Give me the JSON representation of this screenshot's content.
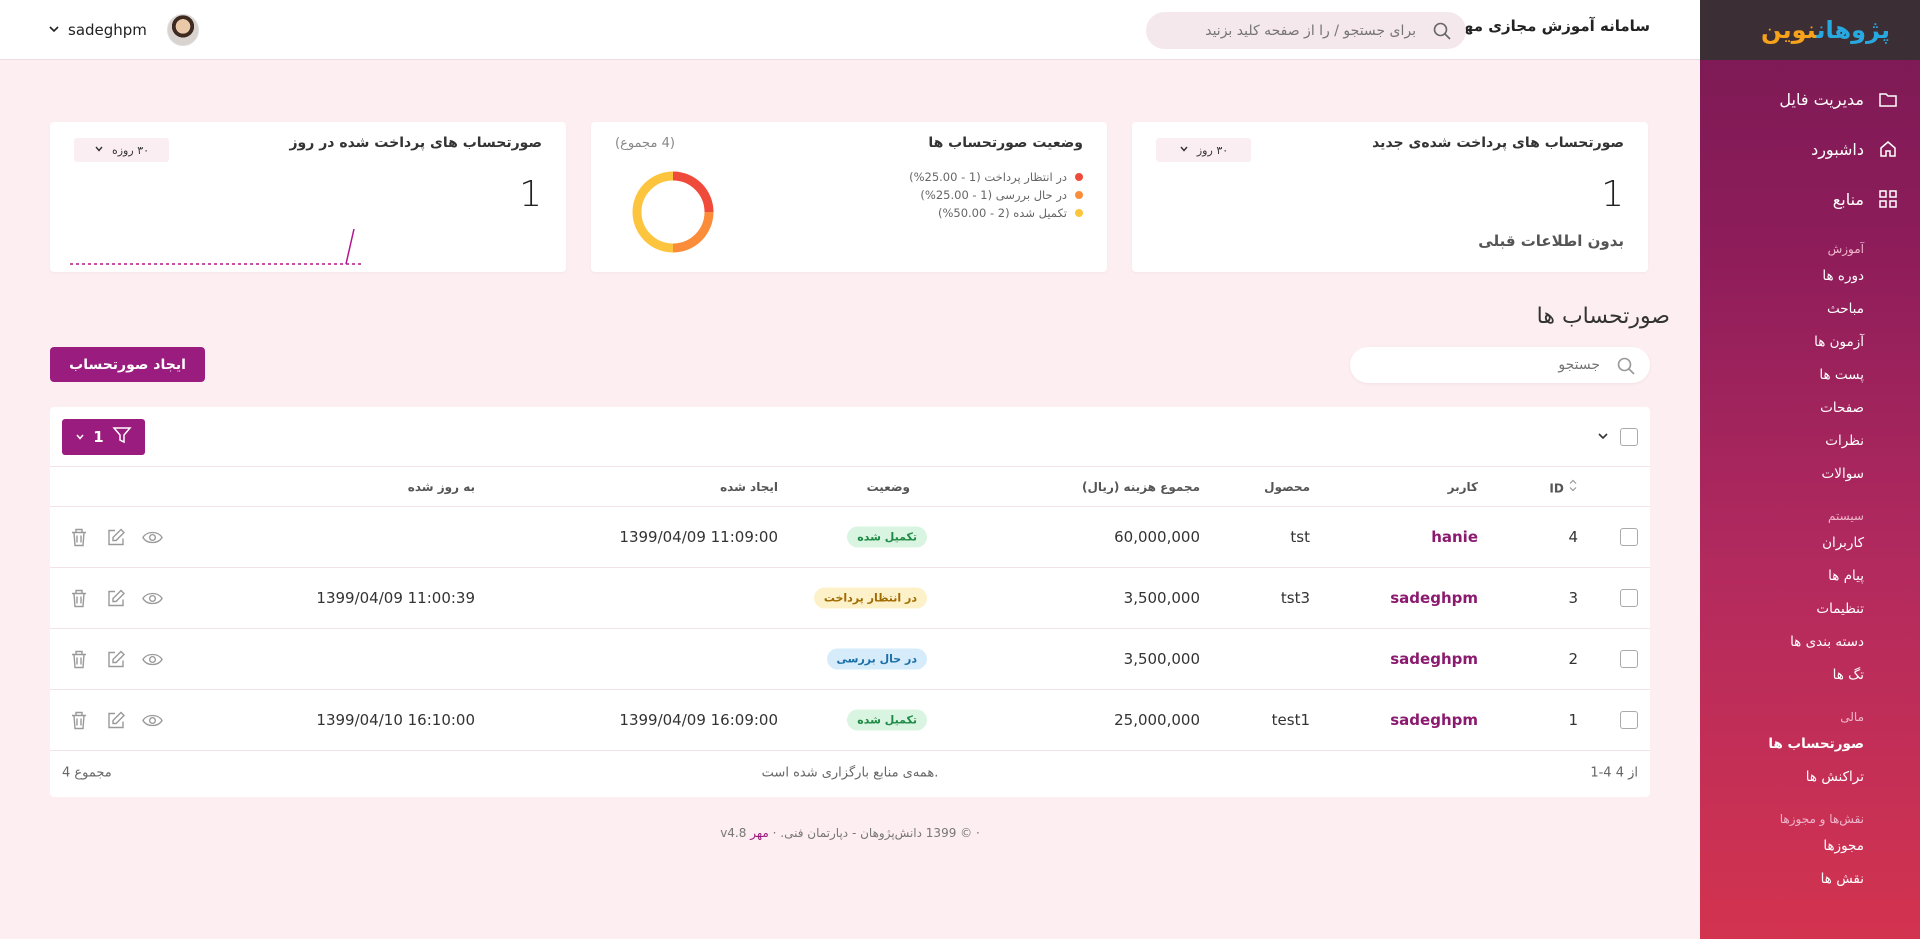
{
  "app": {
    "title": "سامانه آموزش مجازی مهر",
    "logo_text_a": "نوین",
    "logo_text_b": "پژوهان",
    "brand_color": "#9a1c7e"
  },
  "header": {
    "search_placeholder": "برای جستجو / را از صفحه کلید بزنید",
    "username": "sadeghpm"
  },
  "sidebar": {
    "main": [
      {
        "label": "مدیریت فایل",
        "icon": "folder-icon"
      },
      {
        "label": "داشبورد",
        "icon": "home-icon"
      },
      {
        "label": "منابع",
        "icon": "grid-icon"
      }
    ],
    "groups": [
      {
        "title": "آموزش",
        "items": [
          "دوره ها",
          "مباحث",
          "آزمون ها",
          "پست ها",
          "صفحات",
          "نظرات",
          "سوالات"
        ]
      },
      {
        "title": "سیستم",
        "items": [
          "کاربران",
          "پیام ها",
          "تنظیمات",
          "دسته بندی ها",
          "تگ ها"
        ]
      },
      {
        "title": "مالی",
        "items": [
          "صورتحساب ها",
          "تراکنش ها"
        ]
      },
      {
        "title": "نقش‌ها و مجوزها",
        "items": [
          "مجوزها",
          "نقش ها"
        ]
      }
    ],
    "active_item": "صورتحساب ها"
  },
  "cards": {
    "new_paid": {
      "title": "صورتحساب های پرداخت شده‌ی جدید",
      "period": "۳۰ روز",
      "value": "1",
      "sub": "بدون اطلاعات قبلی"
    },
    "status": {
      "title": "وضعیت صورتحساب ها",
      "total_note": "(4 مجموع)",
      "legend": [
        {
          "label": "در انتظار پرداخت (1 - 25.00%)",
          "color": "#f04a3a",
          "fraction": 0.25
        },
        {
          "label": "در حال بررسی (1 - 25.00%)",
          "color": "#fb8c3a",
          "fraction": 0.25
        },
        {
          "label": "تکمیل شده (2 - 50.00%)",
          "color": "#fcc53d",
          "fraction": 0.5
        }
      ]
    },
    "per_day": {
      "title": "صورتحساب های پرداخت شده در روز",
      "period": "۳۰ روزه",
      "value": "1"
    }
  },
  "section": {
    "title": "صورتحساب ها",
    "create_button": "ایجاد صورتحساب",
    "search_placeholder": "جستجو",
    "filter_count": "1"
  },
  "table": {
    "columns": {
      "id": "ID",
      "user": "کاربر",
      "product": "محصول",
      "total": "مجموع هزینه (ریال)",
      "status": "وضعیت",
      "created": "ایجاد شده",
      "updated": "به روز شده"
    },
    "rows": [
      {
        "id": "4",
        "user": "hanie",
        "product": "tst",
        "total": "60,000,000",
        "status": "تکمیل شده",
        "status_kind": "green",
        "created": "1399/04/09 11:09:00",
        "updated": ""
      },
      {
        "id": "3",
        "user": "sadeghpm",
        "product": "tst3",
        "total": "3,500,000",
        "status": "در انتظار پرداخت",
        "status_kind": "yellow",
        "created": "",
        "updated": "1399/04/09 11:00:39"
      },
      {
        "id": "2",
        "user": "sadeghpm",
        "product": "",
        "total": "3,500,000",
        "status": "در حال بررسی",
        "status_kind": "blue",
        "created": "",
        "updated": ""
      },
      {
        "id": "1",
        "user": "sadeghpm",
        "product": "test1",
        "total": "25,000,000",
        "status": "تکمیل شده",
        "status_kind": "green",
        "created": "1399/04/09 16:09:00",
        "updated": "1399/04/10 16:10:00"
      }
    ],
    "footer": {
      "range": "1-4 از 4",
      "loaded": "همه‌ی منابع بارگزاری شده است.",
      "total": "مجموع 4"
    }
  },
  "footer": {
    "copyright": "· © 1399 دانش‌پژوهان - دپارتمان فنی.",
    "sep": "·",
    "brand": "مهر",
    "version": "v4.8"
  }
}
